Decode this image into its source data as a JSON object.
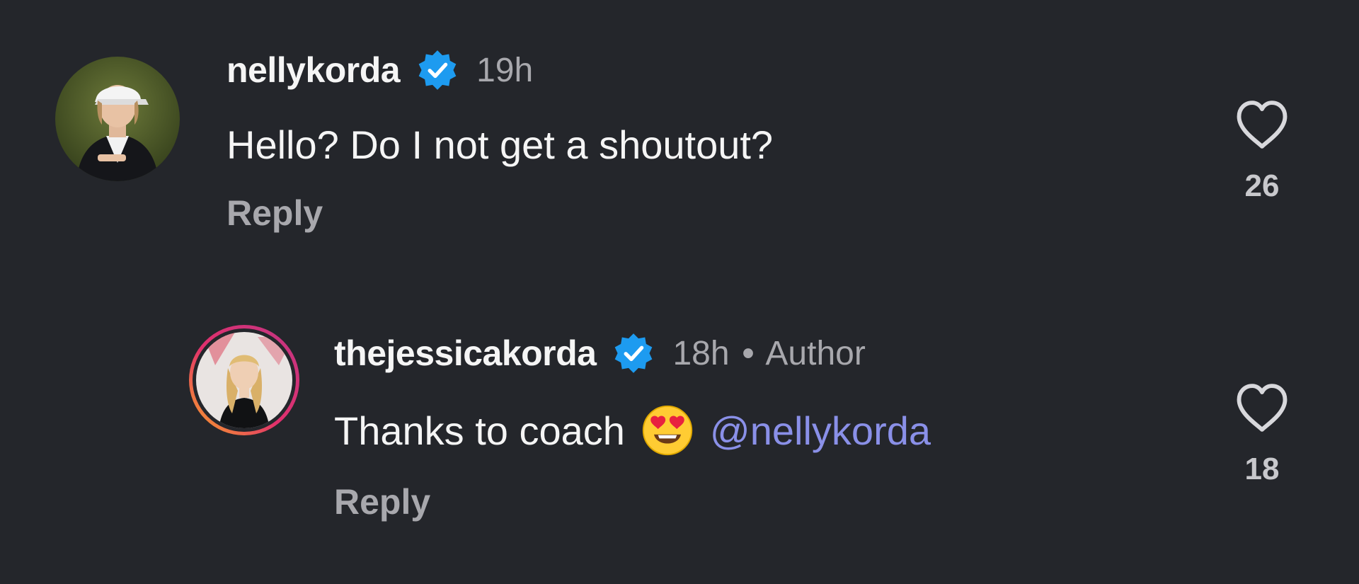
{
  "comments": [
    {
      "username": "nellykorda",
      "verified": true,
      "time": "19h",
      "text": "Hello? Do I not get a shoutout?",
      "reply_label": "Reply",
      "likes": "26",
      "avatar_icon": "profile-photo-golfer-visor"
    },
    {
      "username": "thejessicakorda",
      "verified": true,
      "time": "18h",
      "dot": "•",
      "author_tag": "Author",
      "text": "Thanks to coach",
      "emoji": "smiling-face-with-heart-eyes",
      "mention": "@nellykorda",
      "reply_label": "Reply",
      "likes": "18",
      "avatar_icon": "profile-photo-story-ring"
    }
  ],
  "colors": {
    "background": "#24262b",
    "primary_text": "#f5f5f5",
    "secondary_text": "#a8a8ad",
    "verified_blue": "#1d9bf0",
    "mention": "#8a90e8"
  }
}
